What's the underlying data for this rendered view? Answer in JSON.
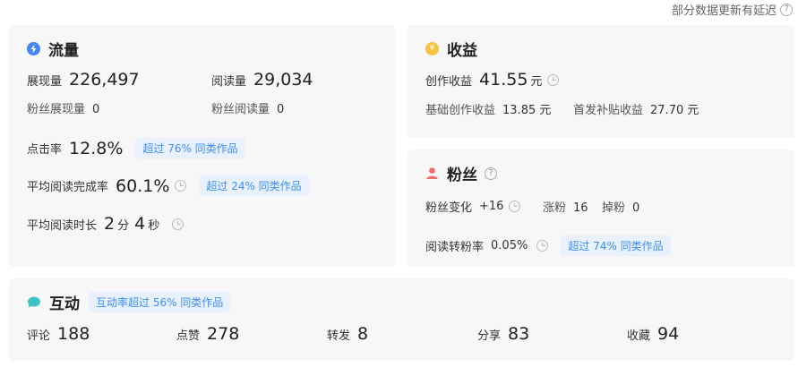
{
  "notice": "部分数据更新有延迟",
  "traffic": {
    "title": "流量",
    "impressions_label": "展现量",
    "impressions_value": "226,497",
    "reads_label": "阅读量",
    "reads_value": "29,034",
    "fan_impressions_label": "粉丝展现量",
    "fan_impressions_value": "0",
    "fan_reads_label": "粉丝阅读量",
    "fan_reads_value": "0",
    "ctr_label": "点击率",
    "ctr_value": "12.8%",
    "ctr_badge": "超过 76% 同类作品",
    "completion_label": "平均阅读完成率",
    "completion_value": "60.1%",
    "completion_badge": "超过 24% 同类作品",
    "duration_label": "平均阅读时长",
    "duration_min": "2",
    "duration_min_unit": "分",
    "duration_sec": "4",
    "duration_sec_unit": "秒"
  },
  "income": {
    "title": "收益",
    "creation_label": "创作收益",
    "creation_value": "41.55",
    "currency": "元",
    "basic_label": "基础创作收益",
    "basic_value": "13.85 元",
    "first_label": "首发补贴收益",
    "first_value": "27.70 元"
  },
  "fans": {
    "title": "粉丝",
    "change_label": "粉丝变化",
    "change_value": "+16",
    "gain_label": "涨粉",
    "gain_value": "16",
    "loss_label": "掉粉",
    "loss_value": "0",
    "conv_label": "阅读转粉率",
    "conv_value": "0.05%",
    "conv_badge": "超过 74% 同类作品"
  },
  "interaction": {
    "title": "互动",
    "badge": "互动率超过 56% 同类作品",
    "items": [
      {
        "label": "评论",
        "value": "188"
      },
      {
        "label": "点赞",
        "value": "278"
      },
      {
        "label": "转发",
        "value": "8"
      },
      {
        "label": "分享",
        "value": "83"
      },
      {
        "label": "收藏",
        "value": "94"
      }
    ]
  },
  "colors": {
    "traffic_icon": "#4285f4",
    "income_icon": "#f6c343",
    "fans_icon": "#f06b6b",
    "interaction_icon": "#3cc4c4",
    "badge_bg": "#e8f1fd",
    "badge_text": "#3f8ef2"
  }
}
